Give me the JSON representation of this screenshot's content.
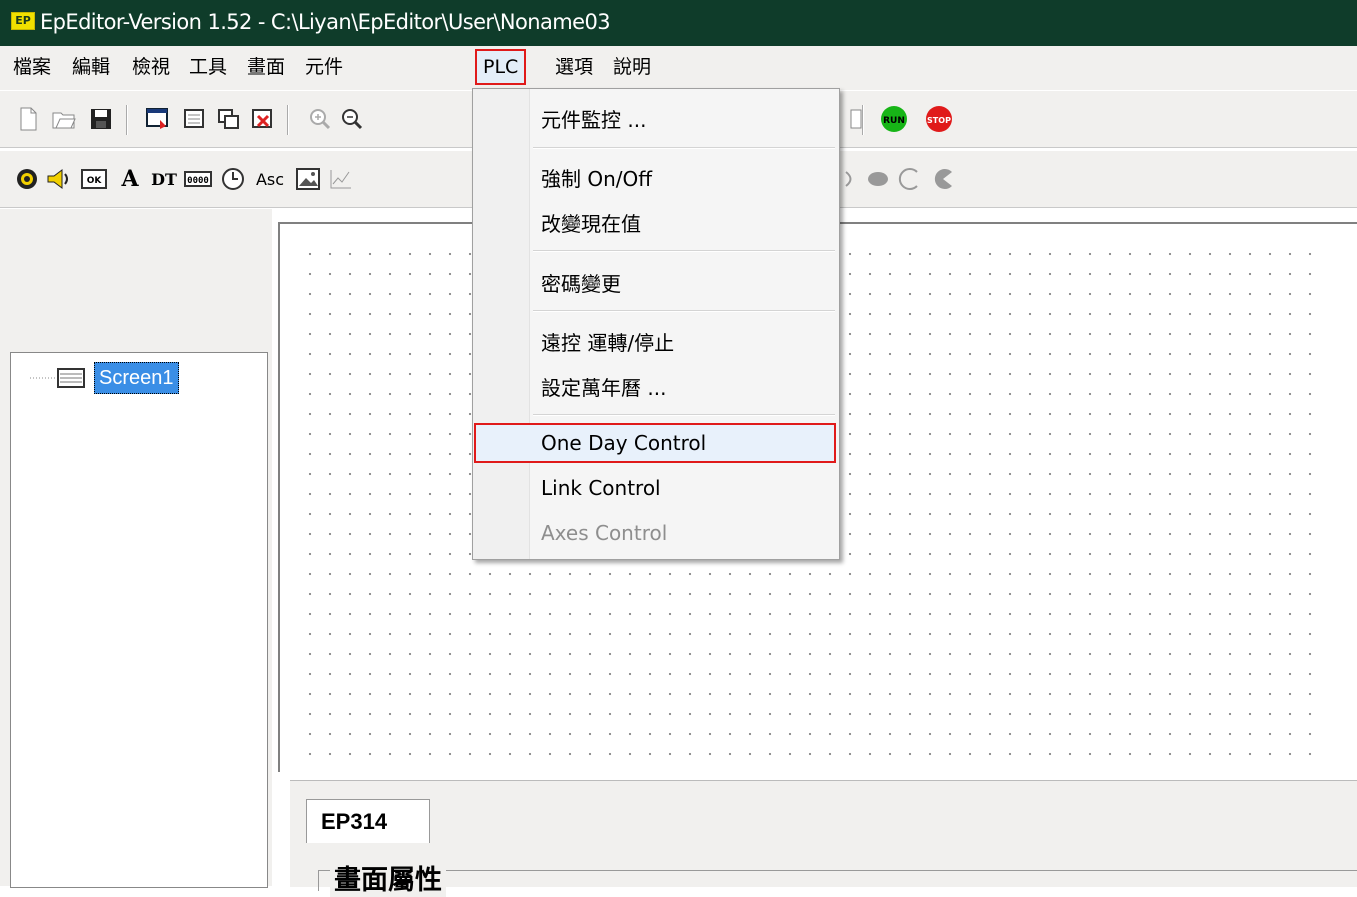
{
  "window": {
    "title": "EpEditor-Version 1.52 - C:\\Liyan\\EpEditor\\User\\Noname03",
    "logo_text": "EP"
  },
  "menubar": {
    "items": [
      "檔案",
      "編輯",
      "檢視",
      "工具",
      "畫面",
      "元件",
      "PLC",
      "選項",
      "說明"
    ],
    "active": "PLC"
  },
  "plc_menu": {
    "items": [
      {
        "label": "元件監控 ...",
        "enabled": true
      },
      {
        "label": "強制 On/Off",
        "enabled": true
      },
      {
        "label": "改變現在值",
        "enabled": true
      },
      {
        "label": "密碼變更",
        "enabled": true
      },
      {
        "label": "遠控 運轉/停止",
        "enabled": true
      },
      {
        "label": "設定萬年曆 ...",
        "enabled": true
      },
      {
        "label": "One Day Control",
        "enabled": true,
        "highlighted": true
      },
      {
        "label": "Link Control",
        "enabled": true
      },
      {
        "label": "Axes Control",
        "enabled": false
      }
    ]
  },
  "toolbar1": {
    "icons": [
      "new-file-icon",
      "open-folder-icon",
      "save-icon",
      "screen-insert-icon",
      "screen-icon",
      "screen-copy-icon",
      "screen-delete-icon",
      "zoom-in-icon",
      "zoom-out-icon",
      "window-icon",
      "run-icon",
      "stop-icon"
    ],
    "run_label": "RUN",
    "stop_label": "STOP"
  },
  "toolbar2": {
    "icons": [
      "lamp-icon",
      "buzzer-icon",
      "ok-button-icon",
      "text-icon",
      "datetime-icon",
      "numeric-icon",
      "clock-icon",
      "ascii-icon",
      "image-icon",
      "trend-icon",
      "circle-icon",
      "ellipse-icon",
      "arc-icon",
      "pie-icon"
    ],
    "ok_label": "OK",
    "text_label": "A",
    "datetime_label": "DT",
    "numeric_label": "0000",
    "ascii_label": "Asc"
  },
  "tree": {
    "node": "Screen1"
  },
  "bottom_panel": {
    "tab": "EP314",
    "group_title": "畫面屬性"
  },
  "colors": {
    "titlebar": "#0f3c2a",
    "highlight_border": "#e01a1a",
    "selection": "#3a8ee6",
    "run": "#17b517",
    "stop": "#e01a1a"
  }
}
